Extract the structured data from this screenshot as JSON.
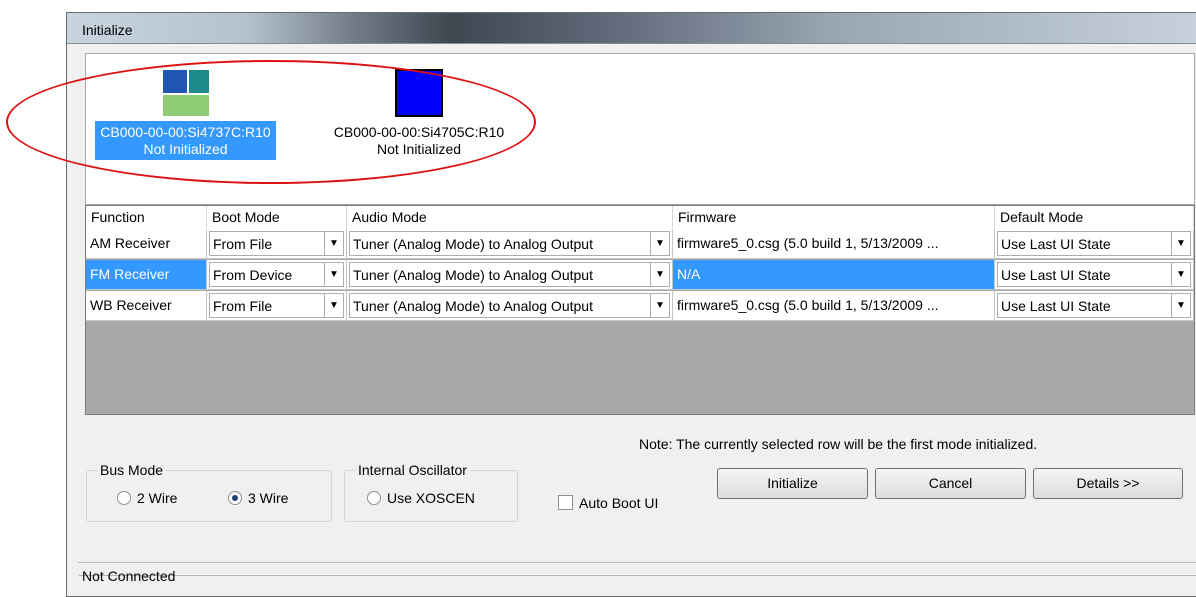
{
  "window": {
    "title": "Initialize"
  },
  "devices": [
    {
      "name": "CB000-00-00:Si4737C:R10",
      "status": "Not Initialized",
      "selected": true
    },
    {
      "name": "CB000-00-00:Si4705C:R10",
      "status": "Not Initialized",
      "selected": false
    }
  ],
  "grid": {
    "headers": [
      "Function",
      "Boot Mode",
      "Audio Mode",
      "Firmware",
      "Default Mode"
    ],
    "rows": [
      {
        "function": "AM Receiver",
        "boot_mode": "From File",
        "audio_mode": "Tuner (Analog Mode) to Analog Output",
        "firmware": "firmware5_0.csg (5.0 build 1, 5/13/2009 ...",
        "default_mode": "Use Last UI State",
        "selected": false
      },
      {
        "function": "FM Receiver",
        "boot_mode": "From Device",
        "audio_mode": "Tuner (Analog Mode) to Analog Output",
        "firmware": "N/A",
        "default_mode": "Use Last UI State",
        "selected": true
      },
      {
        "function": "WB Receiver",
        "boot_mode": "From File",
        "audio_mode": "Tuner (Analog Mode) to Analog Output",
        "firmware": "firmware5_0.csg (5.0 build 1, 5/13/2009 ...",
        "default_mode": "Use Last UI State",
        "selected": false
      }
    ]
  },
  "bus_mode": {
    "label": "Bus Mode",
    "options": [
      {
        "label": "2 Wire",
        "checked": false
      },
      {
        "label": "3 Wire",
        "checked": true
      }
    ]
  },
  "oscillator": {
    "label": "Internal Oscillator",
    "option": "Use XOSCEN",
    "checked": false
  },
  "auto_boot": {
    "label": "Auto Boot UI",
    "checked": false
  },
  "note": "Note: The currently selected row will be the first mode initialized.",
  "buttons": {
    "initialize": "Initialize",
    "cancel": "Cancel",
    "details": "Details >>"
  },
  "status_bar": "Not Connected",
  "colors": {
    "selection": "#3399ff",
    "highlight_oval": "#dd1111",
    "grid_background": "#a8a8a8"
  },
  "icons": [
    "combo-arrow-icon",
    "device-icon"
  ]
}
